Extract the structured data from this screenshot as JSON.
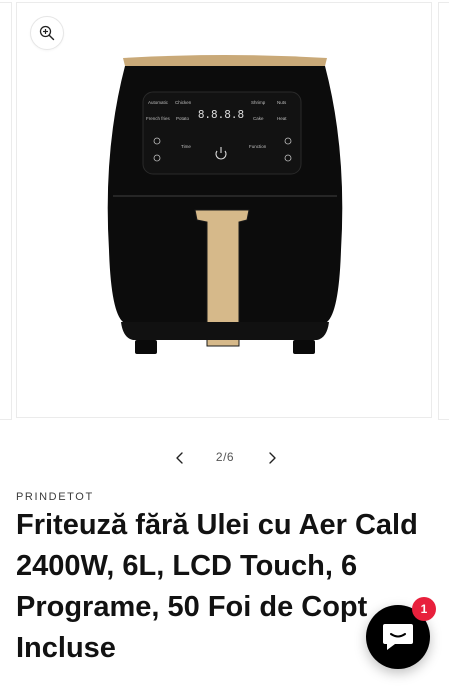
{
  "gallery": {
    "counter": "2/6",
    "zoom_icon": "zoom-in-icon",
    "prev_icon": "chevron-left-icon",
    "next_icon": "chevron-right-icon",
    "image": {
      "brand_color": "#c9a978",
      "body_color": "#0c0c0c",
      "panel_labels": {
        "automatic": "Automatic",
        "chicken": "Chicken",
        "shrimp": "Shrimp",
        "nuts": "Nuts",
        "french_fries": "French fries",
        "potato": "Potato",
        "cake": "Cake",
        "heat": "Heat",
        "time": "Time",
        "function": "Function",
        "display": "8.8.8.8"
      }
    }
  },
  "product": {
    "vendor": "PRINDETOT",
    "title": "Friteuză fără Ulei cu Aer Cald 2400W, 6L, LCD Touch, 6 Programe, 50 Foi de Copt Incluse"
  },
  "chat": {
    "icon": "chat-bubble-icon",
    "badge_count": "1",
    "accent": "#e8203c"
  }
}
